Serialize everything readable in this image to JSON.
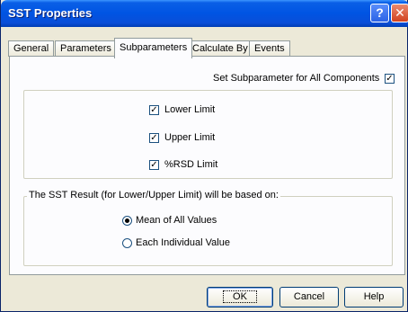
{
  "window": {
    "title": "SST Properties",
    "help_glyph": "?",
    "close_glyph": "✕"
  },
  "tabs": [
    {
      "label": "General"
    },
    {
      "label": "Parameters"
    },
    {
      "label": "Subparameters"
    },
    {
      "label": "Calculate By"
    },
    {
      "label": "Events"
    }
  ],
  "active_tab": "Subparameters",
  "set_all": {
    "label": "Set Subparameter for All Components",
    "checked": true,
    "mark": "✓"
  },
  "limits": [
    {
      "label": "Lower Limit",
      "checked": true,
      "mark": "✓"
    },
    {
      "label": "Upper Limit",
      "checked": true,
      "mark": "✓"
    },
    {
      "label": "%RSD Limit",
      "checked": true,
      "mark": "✓"
    }
  ],
  "result_group": {
    "legend": "The SST Result (for Lower/Upper Limit) will be based on:",
    "options": [
      {
        "label": "Mean of All Values",
        "selected": true
      },
      {
        "label": "Each Individual Value",
        "selected": false
      }
    ]
  },
  "buttons": {
    "ok": "OK",
    "cancel": "Cancel",
    "help": "Help"
  },
  "icons": {
    "help": "help-icon",
    "close": "close-icon"
  }
}
